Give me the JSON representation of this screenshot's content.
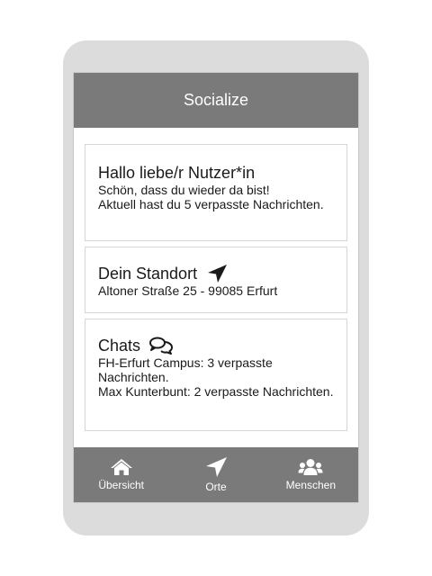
{
  "header": {
    "title": "Socialize"
  },
  "greeting": {
    "title": "Hallo liebe/r Nutzer*in",
    "lines": [
      "Schön, dass du wieder da bist!",
      "Aktuell hast du 5 verpasste Nachrichten."
    ]
  },
  "location": {
    "title": "Dein Standort",
    "icon": "location-arrow-icon",
    "address": "Altoner Straße 25 - 99085 Erfurt"
  },
  "chats": {
    "title": "Chats",
    "icon": "comments-icon",
    "items": [
      "FH-Erfurt Campus: 3 verpasste Nachrichten.",
      "Max Kunterbunt: 2 verpasste Nachrichten."
    ]
  },
  "nav": {
    "items": [
      {
        "label": "Übersicht",
        "icon": "home-icon"
      },
      {
        "label": "Orte",
        "icon": "location-arrow-icon"
      },
      {
        "label": "Menschen",
        "icon": "users-icon"
      }
    ]
  },
  "colors": {
    "bar": "#7a7a7a",
    "frame": "#dcdcdc"
  }
}
